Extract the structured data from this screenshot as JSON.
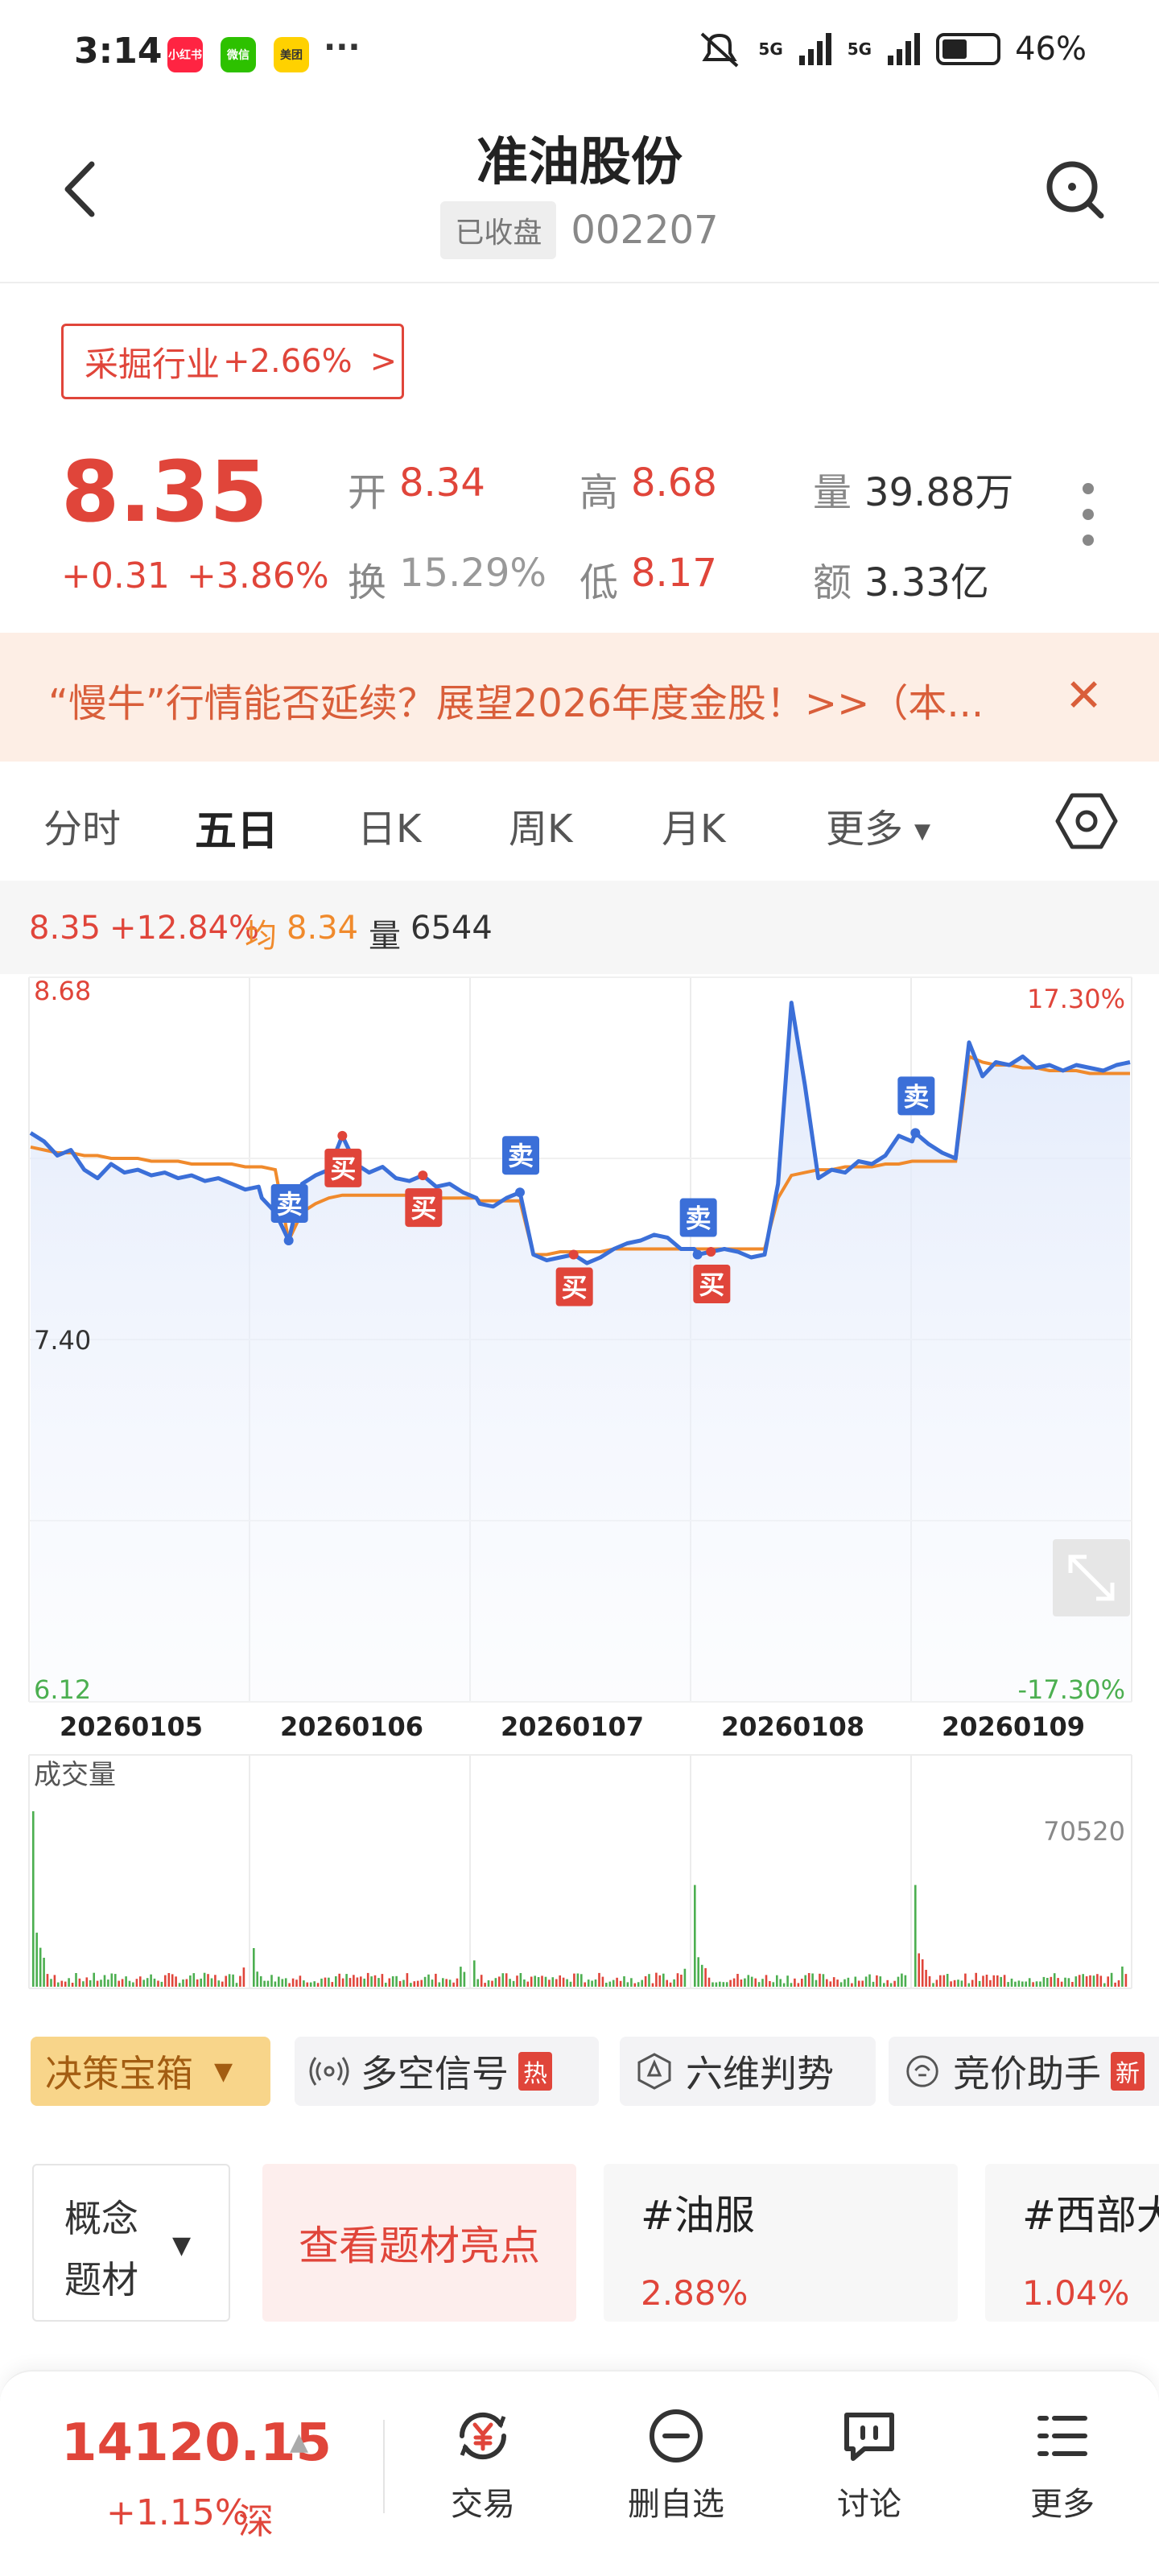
{
  "status_bar": {
    "time": "3:14",
    "apps": [
      {
        "name": "小红书",
        "color": "#ff2442"
      },
      {
        "name": "微信",
        "color": "#2dc100"
      },
      {
        "name": "美团",
        "color": "#ffd100"
      }
    ],
    "more": "···",
    "signal1": "5G",
    "signal2": "5G",
    "battery": "46%",
    "battery_level": 0.46
  },
  "header": {
    "title": "准油股份",
    "status_badge": "已收盘",
    "code": "002207"
  },
  "industry": {
    "label": "采掘行业",
    "change": "+2.66%",
    "chevron": ">"
  },
  "quote": {
    "price": "8.35",
    "change": "+0.31",
    "change_pct": "+3.86%",
    "open_label": "开",
    "open": "8.34",
    "high_label": "高",
    "high": "8.68",
    "volume_label": "量",
    "volume": "39.88万",
    "turnover_label": "换",
    "turnover": "15.29%",
    "low_label": "低",
    "low": "8.17",
    "amount_label": "额",
    "amount": "3.33亿"
  },
  "banner": {
    "text": "“慢牛”行情能否延续？展望2026年度金股！>>（本...",
    "close": "✕"
  },
  "tabs": [
    "分时",
    "五日",
    "日K",
    "周K",
    "月K",
    "更多"
  ],
  "active_tab": "五日",
  "info_strip": {
    "price": "8.35",
    "change_pct": "+12.84%",
    "avg_label": "均",
    "avg": "8.34",
    "vol_label": "量",
    "vol": "6544"
  },
  "chart_data": {
    "type": "line",
    "title": "",
    "y_ticks": [
      "8.68",
      "7.40",
      "6.12"
    ],
    "y_pct_ticks": [
      "17.30%",
      "-17.30%"
    ],
    "ylim": [
      6.12,
      8.68
    ],
    "days": [
      "20260105",
      "20260106",
      "20260107",
      "20260108",
      "20260109"
    ],
    "series": [
      {
        "values": [
          8.13,
          8.1,
          8.05,
          8.07,
          8.0,
          7.97,
          8.02,
          7.99,
          8.0,
          7.98,
          7.99,
          7.97,
          7.98,
          7.96,
          7.97,
          7.95,
          7.93,
          7.94,
          7.9,
          7.85,
          7.75,
          7.95,
          7.98,
          8.0,
          8.12,
          8.02,
          7.99,
          8.01,
          7.97,
          7.96,
          7.98,
          7.94,
          7.95,
          7.92,
          7.9,
          7.88,
          7.87,
          7.9,
          7.92,
          7.7,
          7.68,
          7.69,
          7.7,
          7.67,
          7.69,
          7.72,
          7.74,
          7.75,
          7.77,
          7.76,
          7.72,
          7.72,
          7.7,
          7.71,
          7.72,
          7.71,
          7.69,
          7.7,
          7.95,
          8.59,
          8.3,
          7.97,
          8.0,
          7.99,
          8.03,
          8.02,
          8.05,
          8.12,
          8.1,
          8.13,
          8.09,
          8.06,
          8.04,
          8.45,
          8.33,
          8.38,
          8.37,
          8.4,
          8.36,
          8.37,
          8.35,
          8.37,
          8.36,
          8.35,
          8.37,
          8.38
        ]
      },
      {
        "values": [
          8.08,
          8.07,
          8.06,
          8.06,
          8.05,
          8.05,
          8.04,
          8.04,
          8.04,
          8.03,
          8.03,
          8.03,
          8.02,
          8.02,
          8.02,
          8.02,
          8.01,
          8.01,
          8.01,
          8.0,
          7.75,
          7.85,
          7.88,
          7.9,
          7.91,
          7.91,
          7.91,
          7.91,
          7.91,
          7.91,
          7.9,
          7.9,
          7.9,
          7.9,
          7.9,
          7.89,
          7.89,
          7.89,
          7.89,
          7.7,
          7.7,
          7.71,
          7.71,
          7.71,
          7.71,
          7.72,
          7.72,
          7.72,
          7.72,
          7.72,
          7.72,
          7.72,
          7.72,
          7.72,
          7.72,
          7.72,
          7.72,
          7.72,
          7.9,
          7.98,
          7.99,
          8.0,
          8.0,
          8.01,
          8.01,
          8.01,
          8.02,
          8.02,
          8.03,
          8.03,
          8.03,
          8.03,
          8.03,
          8.4,
          8.38,
          8.37,
          8.37,
          8.36,
          8.36,
          8.35,
          8.35,
          8.35,
          8.34,
          8.34,
          8.34,
          8.34
        ]
      }
    ],
    "markers": [
      {
        "label": "卖",
        "type": "sell",
        "day": 1,
        "pos": 0.2
      },
      {
        "label": "买",
        "type": "buy",
        "day": 1,
        "pos": 0.4
      },
      {
        "label": "买",
        "type": "buy",
        "day": 1,
        "pos": 0.82
      },
      {
        "label": "卖",
        "type": "sell",
        "day": 2,
        "pos": 0.25
      },
      {
        "label": "买",
        "type": "buy",
        "day": 2,
        "pos": 0.45
      },
      {
        "label": "卖",
        "type": "sell",
        "day": 3,
        "pos": 0.03
      },
      {
        "label": "买",
        "type": "buy",
        "day": 3,
        "pos": 0.08
      },
      {
        "label": "卖",
        "type": "sell",
        "day": 4,
        "pos": 0.02
      }
    ],
    "volume_label": "成交量",
    "volume_max": "70520",
    "volume_peaks": [
      1.0,
      0.22,
      0.15,
      0.58,
      0.58
    ]
  },
  "toolbar": {
    "decision": "决策宝箱",
    "signals": "多空信号",
    "hot": "热",
    "six_dim": "六维判势",
    "auction": "竞价助手",
    "new": "新"
  },
  "concepts": {
    "box_label_1": "概念",
    "box_label_2": "题材",
    "view_button": "查看题材亮点",
    "topics": [
      {
        "name": "#油服",
        "pct": "2.88%"
      },
      {
        "name": "#西部大开发",
        "pct": "1.04%"
      }
    ]
  },
  "bottom": {
    "index_value": "14120.15",
    "index_change": "+1.15%",
    "market": "深",
    "nav": [
      "交易",
      "删自选",
      "讨论",
      "更多"
    ]
  },
  "colors": {
    "red": "#e0453a",
    "blue": "#3b6fd8",
    "orange": "#f08a2c",
    "green": "#4caf50"
  }
}
